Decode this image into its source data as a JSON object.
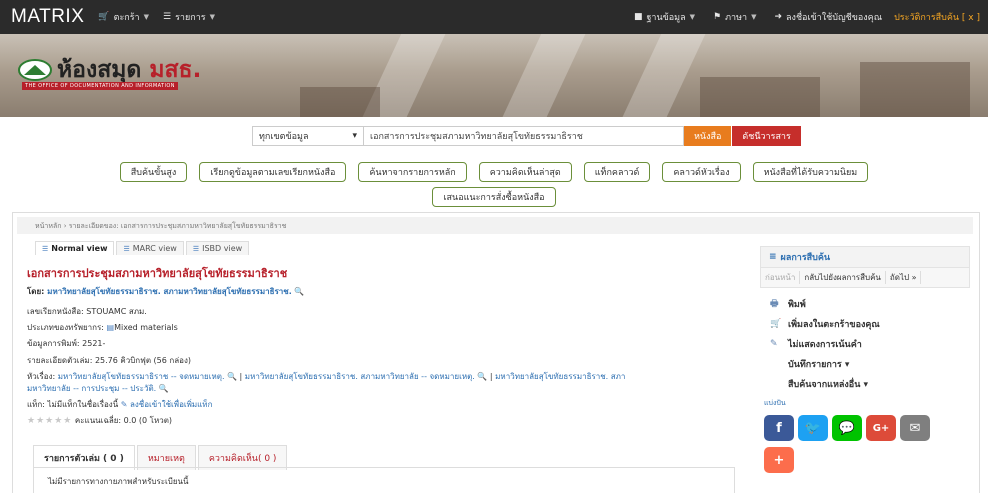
{
  "topbar": {
    "brand": "MATRIX",
    "cart_label": "ตะกร้า",
    "lists_label": "รายการ",
    "database_label": "ฐานข้อมูล",
    "language_label": "ภาษา",
    "login_label": "ลงชื่อเข้าใช้บัญชีของคุณ",
    "history_label": "ประวัติการสืบค้น [ x ]"
  },
  "banner": {
    "logo_main": "ห้องสมุด ",
    "logo_accent": "มสธ.",
    "logo_sub": "THE OFFICE OF DOCUMENTATION AND INFORMATION"
  },
  "search": {
    "scope_value": "ทุกเขตข้อมูล",
    "query_value": "เอกสารการประชุมสภามหาวิทยาลัยสุโขทัยธรรมาธิราช",
    "go_label": "หนังสือ",
    "journal_label": "ดัชนีวารสาร"
  },
  "actions": {
    "row1": [
      "สืบค้นขั้นสูง",
      "เรียกดูข้อมูลตามเลขเรียกหนังสือ",
      "ค้นหาจากรายการหลัก",
      "ความคิดเห็นล่าสุด",
      "แท็กคลาวด์",
      "คลาวด์หัวเรื่อง",
      "หนังสือที่ได้รับความนิยม"
    ],
    "row2": [
      "เสนอแนะการสั่งซื้อหนังสือ"
    ]
  },
  "breadcrumb": "หน้าหลัก › รายละเอียดของ: เอกสารการประชุมสภามหาวิทยาลัยสุโขทัยธรรมาธิราช",
  "views": [
    "Normal view",
    "MARC view",
    "ISBD view"
  ],
  "record": {
    "title": "เอกสารการประชุมสภามหาวิทยาลัยสุโขทัยธรรมาธิราช",
    "author_label": "โดย: ",
    "author_value": "มหาวิทยาลัยสุโขทัยธรรมาธิราช. สภามหาวิทยาลัยสุโขทัยธรรมาธิราช.",
    "callno_label": "เลขเรียกหนังสือ: ",
    "callno_value": "STOUAMC สภม.",
    "type_label": "ประเภทของทรัพยากร: ",
    "type_value": "Mixed materials",
    "pub_label": "ข้อมูลการพิมพ์: ",
    "pub_value": "2521-",
    "desc_label": "รายละเอียดตัวเล่ม: ",
    "desc_value": "25.76 คิวบิกฟุต (56 กล่อง)",
    "subject_label": "หัวเรื่อง: ",
    "subject_1": "มหาวิทยาลัยสุโขทัยธรรมาธิราช -- จดหมายเหตุ.",
    "subject_2": "มหาวิทยาลัยสุโขทัยธรรมาธิราช. สภามหาวิทยาลัย -- จดหมายเหตุ.",
    "subject_3": "มหาวิทยาลัยสุโขทัยธรรมาธิราช. สภา",
    "subject_4": "มหาวิทยาลัย -- การประชุม -- ประวัติ.",
    "tags_label": "แท็ก: ",
    "tags_value": "ไม่มีแท็กในชื่อเรื่องนี้",
    "tags_login": "ลงชื่อเข้าใช้เพื่อเพิ่มแท็ก",
    "rating_text": "คะแนนเฉลี่ย: 0.0 (0 โหวต)"
  },
  "tabs": [
    "รายการตัวเล่ม ( 0 )",
    "หมายเหตุ",
    "ความคิดเห็น( 0 )"
  ],
  "tab_body": "ไม่มีรายการทางกายภาพสำหรับระเบียนนี้",
  "sidebar": {
    "header": "ผลการสืบค้น",
    "prev": "ก่อนหน้า",
    "back": "กลับไปยังผลการสืบค้น",
    "next": "ถัดไป »",
    "print": "พิมพ์",
    "add_cart": "เพิ่มลงในตะกร้าของคุณ",
    "no_highlight": "ไม่แสดงการเน้นคำ",
    "save_record": "บันทึกรายการ ▾",
    "search_other": "สืบค้นจากแหล่งอื่น ▾",
    "share_label": "แบ่งปัน"
  },
  "colors": {
    "topbar": "#2b2b2b",
    "accent_red": "#b7202a",
    "orange": "#e87c1e",
    "button_border": "#6b8f3a",
    "facebook": "#3b5998",
    "twitter": "#1da1f2",
    "line": "#00c300",
    "gplus": "#dd4b39",
    "email": "#7f7f7f",
    "more": "#fc6d4c"
  }
}
